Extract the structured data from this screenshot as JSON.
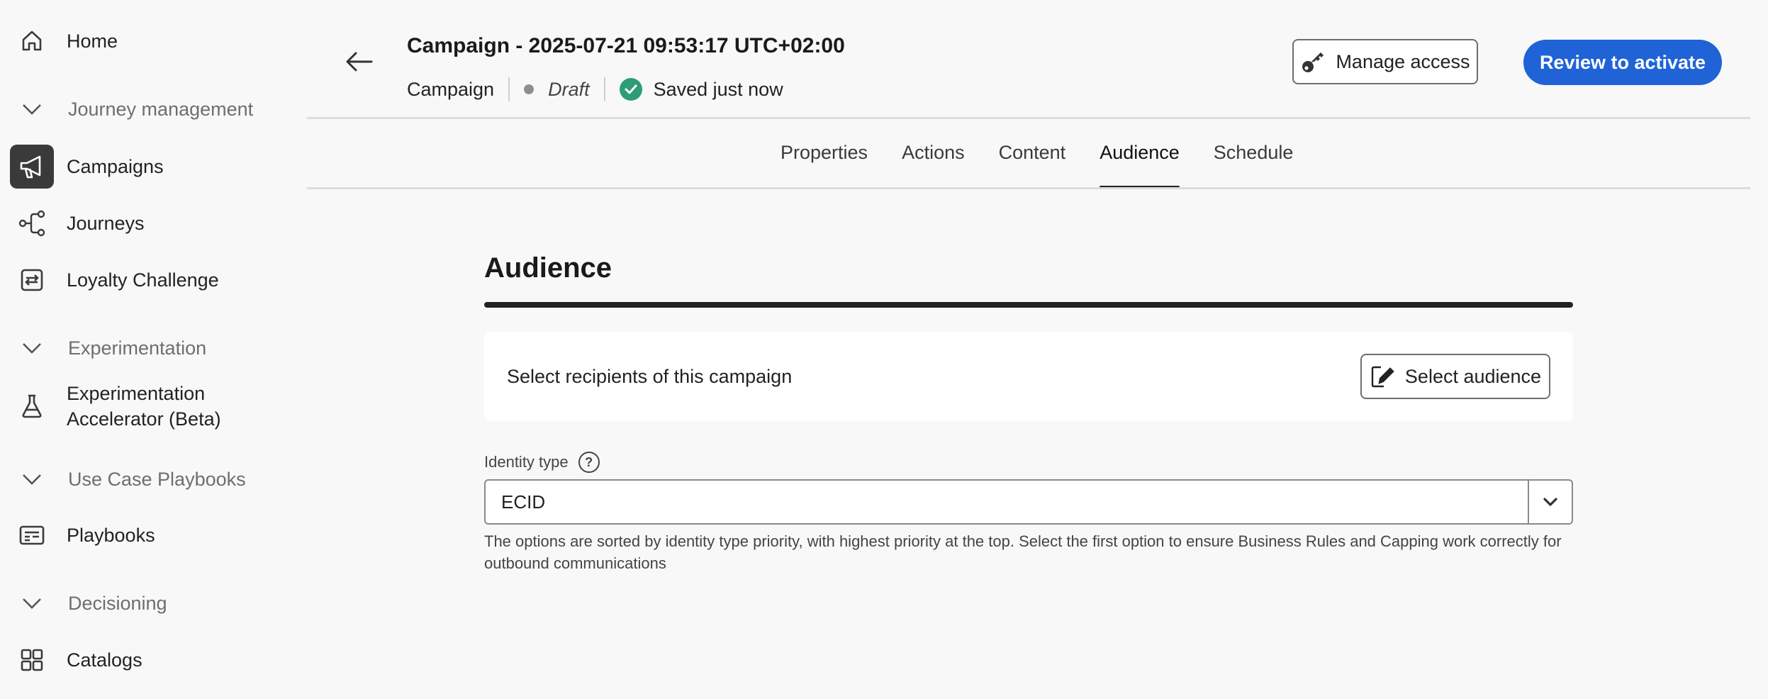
{
  "sidebar": {
    "items": [
      {
        "label": "Home"
      },
      {
        "section": "Journey management"
      },
      {
        "label": "Campaigns"
      },
      {
        "label": "Journeys"
      },
      {
        "label": "Loyalty Challenge"
      },
      {
        "section": "Experimentation"
      },
      {
        "label": "Experimentation Accelerator (Beta)"
      },
      {
        "section": "Use Case Playbooks"
      },
      {
        "label": "Playbooks"
      },
      {
        "section": "Decisioning"
      },
      {
        "label": "Catalogs"
      }
    ],
    "active_item": "Campaigns"
  },
  "header": {
    "title": "Campaign - 2025-07-21 09:53:17 UTC+02:00",
    "type": "Campaign",
    "status": "Draft",
    "save_status": "Saved just now",
    "manage_access_label": "Manage access",
    "review_label": "Review to activate"
  },
  "tabs": [
    {
      "label": "Properties"
    },
    {
      "label": "Actions"
    },
    {
      "label": "Content"
    },
    {
      "label": "Audience"
    },
    {
      "label": "Schedule"
    }
  ],
  "active_tab": "Audience",
  "main": {
    "section_title": "Audience",
    "recipients_text": "Select recipients of this campaign",
    "select_audience_label": "Select audience",
    "identity_type_label": "Identity type",
    "identity_type_value": "ECID",
    "help_text": "The options are sorted by identity type priority, with highest priority at the top. Select the first option to ensure Business Rules and Capping work correctly for outbound communications"
  },
  "colors": {
    "primary": "#1f63d6",
    "success": "#2d9d78",
    "active_nav_bg": "#3a3a3a"
  }
}
